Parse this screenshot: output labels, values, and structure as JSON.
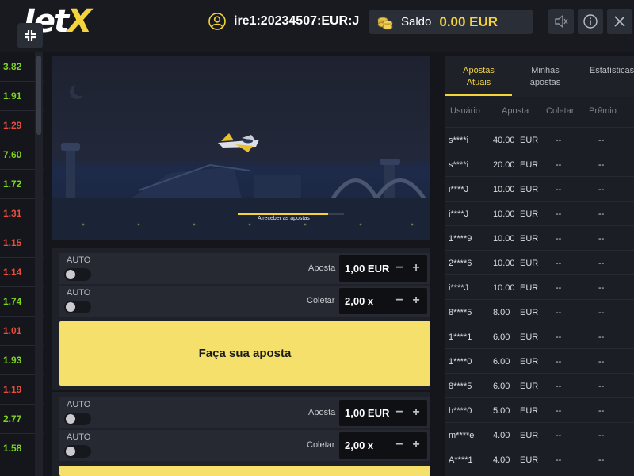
{
  "header": {
    "logo_main": "Jet",
    "logo_x": "X",
    "username": "ire1:20234507:EUR:J",
    "balance_label": "Saldo",
    "balance_value": "0.00 EUR",
    "sound_icon": "speaker-muted-icon",
    "info_icon": "info-icon",
    "close_icon": "close-icon",
    "collapse_icon": "collapse-icon"
  },
  "history": [
    {
      "value": "3.82",
      "color": "#7ed321"
    },
    {
      "value": "1.91",
      "color": "#7ed321"
    },
    {
      "value": "1.29",
      "color": "#e84c3d"
    },
    {
      "value": "7.60",
      "color": "#7ed321"
    },
    {
      "value": "1.72",
      "color": "#7ed321"
    },
    {
      "value": "1.31",
      "color": "#e84c3d"
    },
    {
      "value": "1.15",
      "color": "#e84c3d"
    },
    {
      "value": "1.14",
      "color": "#e84c3d"
    },
    {
      "value": "1.74",
      "color": "#7ed321"
    },
    {
      "value": "1.01",
      "color": "#e84c3d"
    },
    {
      "value": "1.93",
      "color": "#7ed321"
    },
    {
      "value": "1.19",
      "color": "#e84c3d"
    },
    {
      "value": "2.77",
      "color": "#7ed321"
    },
    {
      "value": "1.58",
      "color": "#7ed321"
    }
  ],
  "game": {
    "status_text": "A receber as apostas",
    "status_progress": 0.85
  },
  "bet_panels": [
    {
      "auto_label_1": "AUTO",
      "bet_label": "Aposta",
      "bet_value": "1,00 EUR",
      "auto_label_2": "AUTO",
      "collect_label": "Coletar",
      "collect_value": "2,00 x",
      "place_bet_label": "Faça sua aposta"
    },
    {
      "auto_label_1": "AUTO",
      "bet_label": "Aposta",
      "bet_value": "1,00 EUR",
      "auto_label_2": "AUTO",
      "collect_label": "Coletar",
      "collect_value": "2,00 x",
      "place_bet_label": ""
    }
  ],
  "right_panel": {
    "tabs": [
      {
        "label_line1": "Apostas",
        "label_line2": "Atuais",
        "active": true
      },
      {
        "label_line1": "Minhas",
        "label_line2": "apostas",
        "active": false
      },
      {
        "label_line1": "Estatísticas",
        "label_line2": "",
        "active": false
      }
    ],
    "columns": [
      "Usuário",
      "Aposta",
      "Coletar",
      "Prêmio"
    ],
    "rows": [
      {
        "user": "s****i",
        "bet": "40.00",
        "currency": "EUR",
        "collect": "--",
        "prize": "--"
      },
      {
        "user": "s****i",
        "bet": "20.00",
        "currency": "EUR",
        "collect": "--",
        "prize": "--"
      },
      {
        "user": "i****J",
        "bet": "10.00",
        "currency": "EUR",
        "collect": "--",
        "prize": "--"
      },
      {
        "user": "i****J",
        "bet": "10.00",
        "currency": "EUR",
        "collect": "--",
        "prize": "--"
      },
      {
        "user": "1****9",
        "bet": "10.00",
        "currency": "EUR",
        "collect": "--",
        "prize": "--"
      },
      {
        "user": "2****6",
        "bet": "10.00",
        "currency": "EUR",
        "collect": "--",
        "prize": "--"
      },
      {
        "user": "i****J",
        "bet": "10.00",
        "currency": "EUR",
        "collect": "--",
        "prize": "--"
      },
      {
        "user": "8****5",
        "bet": "8.00",
        "currency": "EUR",
        "collect": "--",
        "prize": "--"
      },
      {
        "user": "1****1",
        "bet": "6.00",
        "currency": "EUR",
        "collect": "--",
        "prize": "--"
      },
      {
        "user": "1****0",
        "bet": "6.00",
        "currency": "EUR",
        "collect": "--",
        "prize": "--"
      },
      {
        "user": "8****5",
        "bet": "6.00",
        "currency": "EUR",
        "collect": "--",
        "prize": "--"
      },
      {
        "user": "h****0",
        "bet": "5.00",
        "currency": "EUR",
        "collect": "--",
        "prize": "--"
      },
      {
        "user": "m****e",
        "bet": "4.00",
        "currency": "EUR",
        "collect": "--",
        "prize": "--"
      },
      {
        "user": "A****1",
        "bet": "4.00",
        "currency": "EUR",
        "collect": "--",
        "prize": "--"
      }
    ]
  },
  "colors": {
    "accent": "#f5d33c",
    "win": "#7ed321",
    "loss": "#e84c3d",
    "bet_button": "#f5e06b"
  }
}
